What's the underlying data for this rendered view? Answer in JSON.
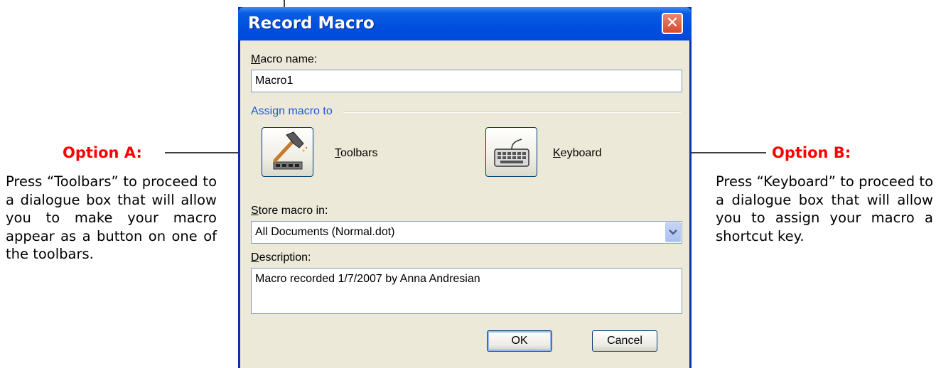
{
  "annotations": {
    "option_a": {
      "title": "Option A:",
      "text": "Press “Toolbars” to proceed to a dialogue box that will allow you to make your macro appear as a button on one of the toolbars."
    },
    "option_b": {
      "title": "Option B:",
      "text": "Press “Keyboard” to proceed to a dialogue box that will allow you to assign your macro a shortcut key."
    },
    "accent_color": "#ff0000"
  },
  "dialog": {
    "title": "Record Macro",
    "close_icon": "close-icon",
    "macro_name": {
      "label_first": "M",
      "label_rest": "acro name:",
      "value": "Macro1"
    },
    "assign_group": {
      "label": "Assign macro to",
      "toolbars": {
        "label_first": "T",
        "label_rest": "oolbars",
        "icon": "hammer-toolbar-icon"
      },
      "keyboard": {
        "label_first": "K",
        "label_rest": "eyboard",
        "icon": "keyboard-icon"
      }
    },
    "store_in": {
      "label_first": "S",
      "label_rest": "tore macro in:",
      "selected": "All Documents (Normal.dot)"
    },
    "description": {
      "label_first": "D",
      "label_rest": "escription:",
      "value": "Macro recorded 1/7/2007 by Anna Andresian"
    },
    "buttons": {
      "ok": "OK",
      "cancel": "Cancel"
    }
  }
}
